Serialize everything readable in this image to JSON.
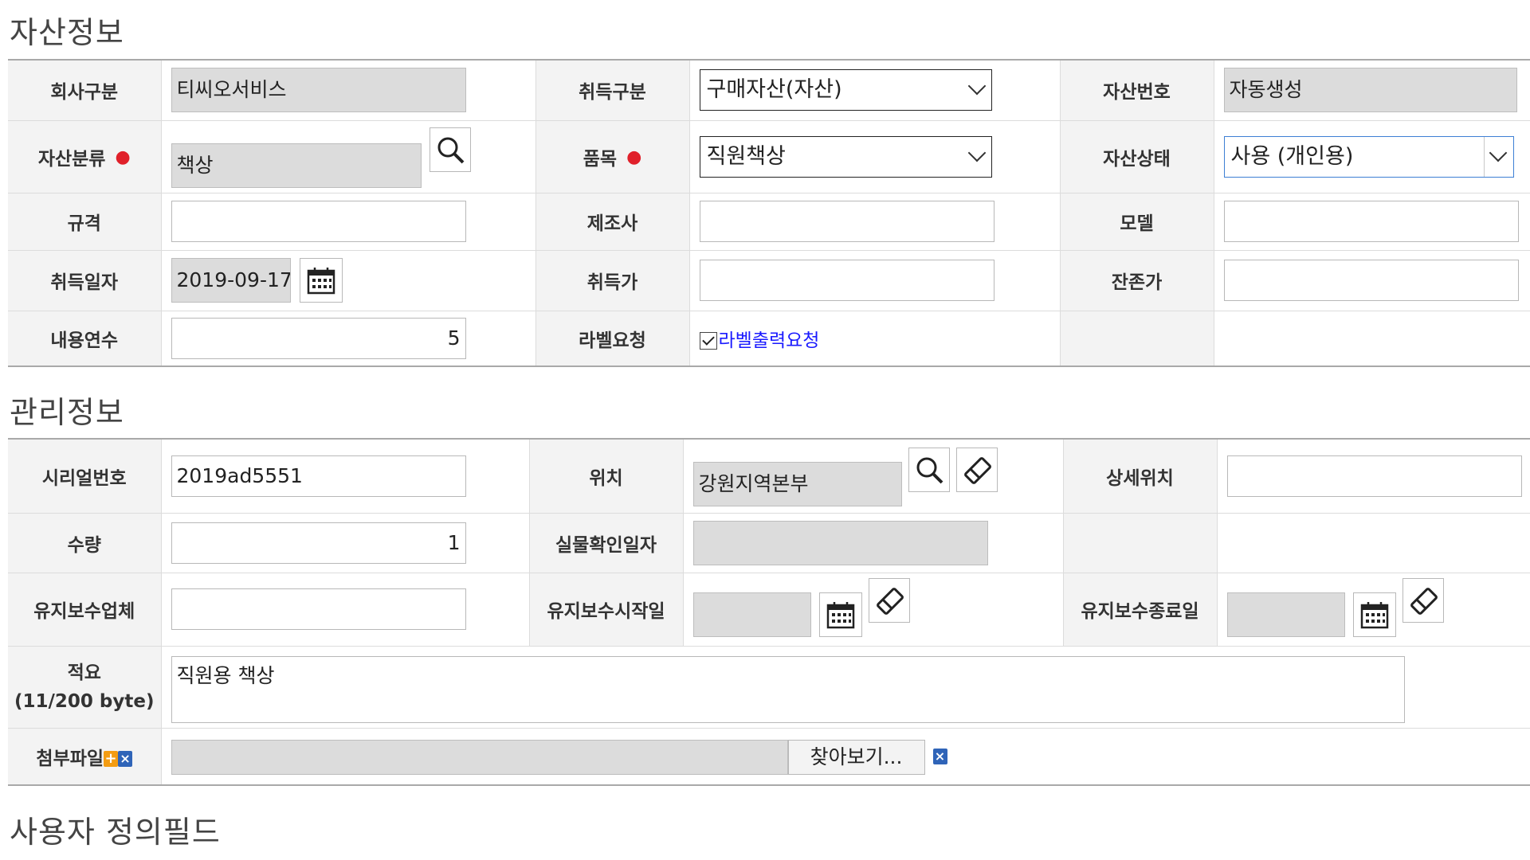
{
  "sections": {
    "asset_info": "자산정보",
    "management_info": "관리정보",
    "user_defined": "사용자 정의필드"
  },
  "asset": {
    "company_label": "회사구분",
    "company_value": "티씨오서비스",
    "acq_type_label": "취득구분",
    "acq_type_value": "구매자산(자산)",
    "asset_no_label": "자산번호",
    "asset_no_value": "자동생성",
    "category_label": "자산분류",
    "category_value": "책상",
    "item_label": "품목",
    "item_value": "직원책상",
    "status_label": "자산상태",
    "status_value": "사용 (개인용)",
    "spec_label": "규격",
    "maker_label": "제조사",
    "model_label": "모델",
    "acq_date_label": "취득일자",
    "acq_date_value": "2019-09-17",
    "acq_price_label": "취득가",
    "residual_label": "잔존가",
    "life_label": "내용연수",
    "life_value": "5",
    "label_req_label": "라벨요청",
    "label_req_check": "라벨출력요청"
  },
  "mgmt": {
    "serial_label": "시리얼번호",
    "serial_value": "2019ad5551",
    "location_label": "위치",
    "location_value": "강원지역본부",
    "detail_loc_label": "상세위치",
    "qty_label": "수량",
    "qty_value": "1",
    "verify_date_label": "실물확인일자",
    "vendor_label": "유지보수업체",
    "maint_start_label": "유지보수시작일",
    "maint_end_label": "유지보수종료일",
    "memo_label": "적요",
    "memo_count": "(11/200 byte)",
    "memo_value": "직원용 책상",
    "attach_label": "첨부파일",
    "browse_label": "찾아보기..."
  },
  "icons": {
    "search": "search-icon",
    "eraser": "eraser-icon",
    "calendar": "calendar-icon",
    "remove": "remove-icon",
    "add": "add-icon"
  },
  "colors": {
    "required_dot": "#e0202a",
    "link_blue": "#1a1aff",
    "label_bg": "#f3f3f3",
    "readonly_bg": "#dcdcdc"
  }
}
